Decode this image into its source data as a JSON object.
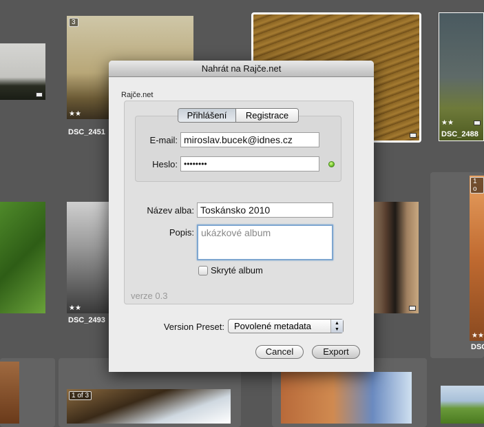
{
  "background": {
    "thumbs": [
      {
        "label": "DSC_2451",
        "badge": "3",
        "stars": "★★"
      },
      {
        "label": "DSC_2488",
        "stars": "★★"
      },
      {
        "label": "DSC_2493",
        "stars": "★★"
      },
      {
        "label": "DSC",
        "badge": "1 o",
        "stars": "★★"
      },
      {
        "badge": "1 of 3"
      }
    ],
    "first_stars": "★★"
  },
  "dialog": {
    "title": "Nahrát na Rajče.net",
    "group_label": "Rajče.net",
    "tabs": [
      {
        "label": "Přihlášení",
        "selected": true
      },
      {
        "label": "Registrace",
        "selected": false
      }
    ],
    "email_label": "E-mail:",
    "email_value": "miroslav.bucek@idnes.cz",
    "password_label": "Heslo:",
    "password_value": "••••••••",
    "status_color": "#6fc02a",
    "album_name_label": "Název alba:",
    "album_name_value": "Toskánsko 2010",
    "description_label": "Popis:",
    "description_value": "ukázkové album",
    "hidden_label": "Skryté album",
    "hidden_checked": false,
    "version": "verze 0.3",
    "preset_label": "Version Preset:",
    "preset_value": "Povolené metadata",
    "cancel": "Cancel",
    "export": "Export"
  }
}
